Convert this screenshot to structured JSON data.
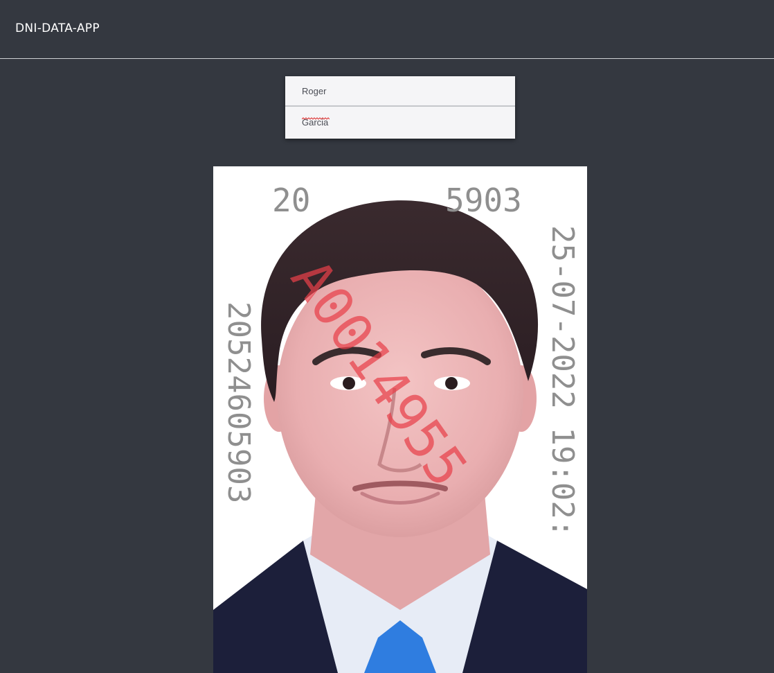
{
  "app": {
    "title": "DNI-DATA-APP"
  },
  "form": {
    "first_name": {
      "value": "Roger"
    },
    "last_name": {
      "value": "Garcia"
    }
  },
  "photo": {
    "top_number": "2052460590 3",
    "top_number_visible": "20",
    "top_number_tail": "5903",
    "left_number": "20524605903",
    "right_stamp": "25-07-2022 19:02:",
    "red_watermark": "A0014955"
  },
  "colors": {
    "background": "#343840",
    "input_background": "#f5f5f7",
    "watermark_red": "#e8404a",
    "stamp_gray": "#8f8f8f"
  }
}
